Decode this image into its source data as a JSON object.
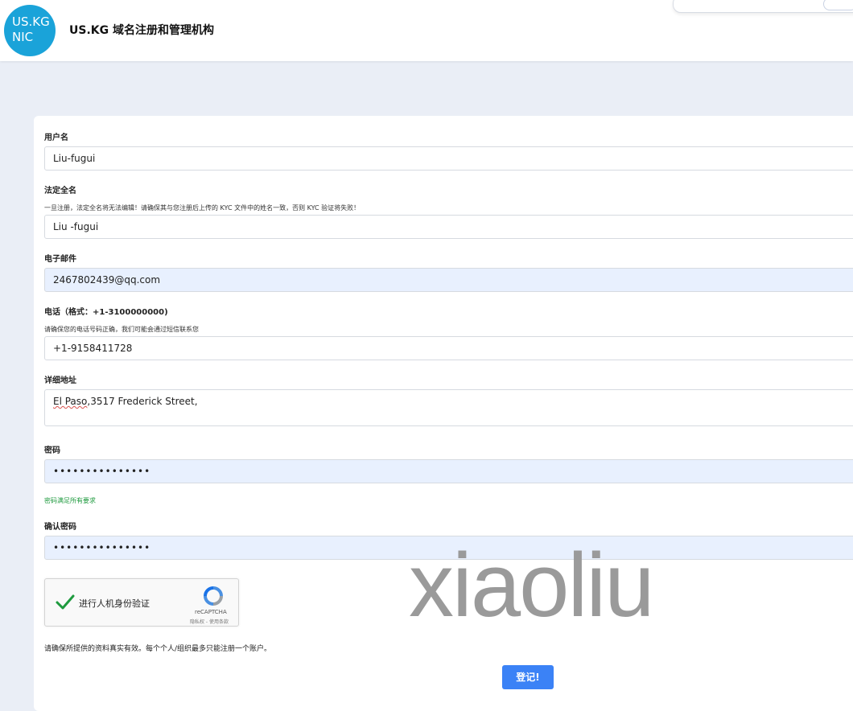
{
  "header": {
    "logo_line1": "US.KG",
    "logo_line2": "NIC",
    "title": "US.KG 域名注册和管理机构"
  },
  "form": {
    "username": {
      "label": "用户名",
      "value": "Liu-fugui"
    },
    "legal_name": {
      "label": "法定全名",
      "hint": "一旦注册，法定全名将无法编辑！请确保其与您注册后上传的 KYC 文件中的姓名一致，否则 KYC 验证将失败！",
      "value": "Liu -fugui"
    },
    "email": {
      "label": "电子邮件",
      "value": "2467802439@qq.com"
    },
    "phone": {
      "label": "电话（格式：+1-3100000000)",
      "hint": "请确保您的电话号码正确，我们可能会通过短信联系您",
      "value": "+1-9158411728"
    },
    "address": {
      "label": "详细地址",
      "value_part1": "El Paso",
      "value_part2": ",3517 Frederick Street,"
    },
    "password": {
      "label": "密码",
      "value": "•••••••••••••••",
      "status": "密码满足所有要求"
    },
    "confirm_password": {
      "label": "确认密码",
      "value": "•••••••••••••••"
    },
    "captcha": {
      "text": "进行人机身份验证",
      "brand": "reCAPTCHA",
      "terms": "隐私权 - 使用条款"
    },
    "notice": "请确保所提供的资料真实有效。每个个人/组织最多只能注册一个账户。",
    "submit_label": "登记!"
  },
  "watermark": "xiaoliu",
  "colors": {
    "logo": "#1aa3d9",
    "submit": "#3b82f6",
    "success": "#1e9a3e",
    "autofill": "#e8f0fe"
  }
}
